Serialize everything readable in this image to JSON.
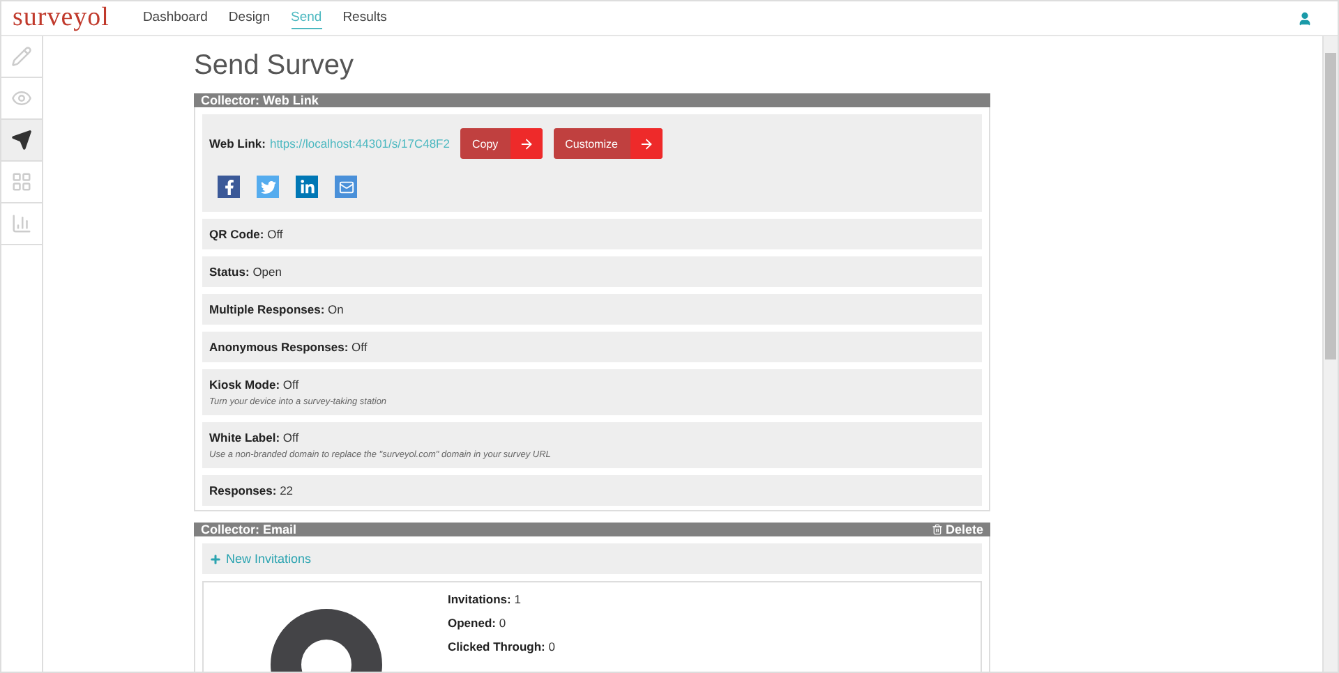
{
  "brand": "surveyol",
  "nav": [
    {
      "label": "Dashboard",
      "selected": false
    },
    {
      "label": "Design",
      "selected": false
    },
    {
      "label": "Send",
      "selected": true
    },
    {
      "label": "Results",
      "selected": false
    }
  ],
  "sidebar": [
    {
      "kind": "edit",
      "selected": false
    },
    {
      "kind": "preview",
      "selected": false
    },
    {
      "kind": "send",
      "selected": true
    },
    {
      "kind": "grid",
      "selected": false
    },
    {
      "kind": "chart",
      "selected": false
    }
  ],
  "title": "Send Survey",
  "web_collector": {
    "title": "Collector: Web Link",
    "link_label": "Web Link:",
    "link": "https://localhost:44301/s/17C48F2",
    "buttons": [
      "Copy",
      "Customize"
    ],
    "share": [
      {
        "kind": "facebook"
      },
      {
        "kind": "twitter"
      },
      {
        "kind": "linkedin"
      },
      {
        "kind": "email"
      }
    ],
    "settings": [
      {
        "label": "QR Code:",
        "value": "Off"
      },
      {
        "label": "Status:",
        "value": "Open"
      },
      {
        "label": "Multiple Responses:",
        "value": "On"
      },
      {
        "label": "Anonymous Responses:",
        "value": "Off"
      },
      {
        "label": "Kiosk Mode:",
        "value": "Off",
        "note": "Turn your device into a survey-taking station"
      },
      {
        "label": "White Label:",
        "value": "Off",
        "note": "Use a non-branded domain to replace the \"surveyol.com\" domain in your survey URL"
      },
      {
        "label": "Responses:",
        "value": "22"
      }
    ]
  },
  "email_collector": {
    "title": "Collector: Email",
    "delete": "Delete",
    "new_invitations": "New Invitations",
    "stats": [
      {
        "label": "Invitations:",
        "value": "1"
      },
      {
        "label": "Opened:",
        "value": "0"
      },
      {
        "label": "Clicked Through:",
        "value": "0"
      }
    ]
  }
}
